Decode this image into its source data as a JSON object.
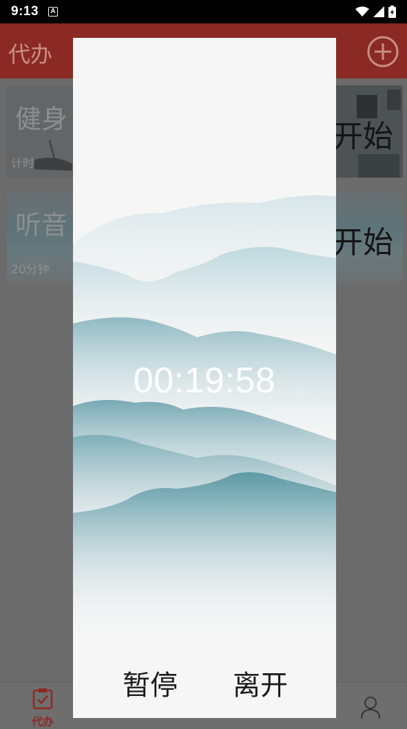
{
  "status_bar": {
    "time": "9:13",
    "a_icon": "A",
    "icons": [
      "wifi-icon",
      "signal-icon",
      "battery-icon"
    ]
  },
  "header": {
    "title": "代办",
    "add_icon": "plus-circle-icon"
  },
  "tasks": [
    {
      "title": "健身",
      "subtitle": "计时",
      "action": "开始"
    },
    {
      "title": "听音",
      "subtitle": "20分钟",
      "action": "开始"
    }
  ],
  "bottom_nav": {
    "todo_label": "代办",
    "todo_icon": "clipboard-check-icon",
    "user_icon": "user-icon"
  },
  "dialog": {
    "timer": "00:19:58",
    "pause_label": "暂停",
    "leave_label": "离开"
  },
  "colors": {
    "accent": "#c0392b",
    "mountain": "#5e9aa6",
    "dialog_bg": "#f6f6f6"
  }
}
